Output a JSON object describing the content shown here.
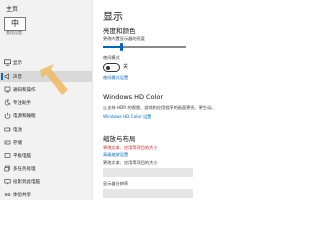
{
  "sidebar": {
    "title": "主页",
    "search_value": "中",
    "search_caption": "查找设置",
    "items": [
      {
        "label": "显示",
        "icon": "monitor-icon"
      },
      {
        "label": "声音",
        "icon": "speaker-icon",
        "selected": true
      },
      {
        "label": "通知和操作",
        "icon": "notification-icon"
      },
      {
        "label": "专注助手",
        "icon": "moon-icon"
      },
      {
        "label": "电源和睡眠",
        "icon": "power-icon"
      },
      {
        "label": "电池",
        "icon": "battery-icon"
      },
      {
        "label": "存储",
        "icon": "storage-icon"
      },
      {
        "label": "平板电脑",
        "icon": "tablet-icon"
      },
      {
        "label": "多任务处理",
        "icon": "multitask-icon"
      },
      {
        "label": "投影到此电脑",
        "icon": "project-icon"
      },
      {
        "label": "体验共享",
        "icon": "share-icon"
      }
    ]
  },
  "main": {
    "title": "显示",
    "brightness_section": "亮度和颜色",
    "brightness_label": "更改内置显示器的亮度",
    "brightness_percent": 22,
    "night_light_label": "夜间模式",
    "night_light_state": "关",
    "night_light_link": "夜间模式设置",
    "hdr_section": "Windows HD Color",
    "hdr_desc": "让支持 HDR 的视频、游戏和应用程序的画面更亮、更生动。",
    "hdr_link": "Windows HD Color 设置",
    "scale_section": "缩放与布局",
    "scale_link1": "更改文本、应用等项目的大小",
    "scale_link2": "高级缩放设置",
    "scale_label": "更改文本、应用等项目的大小",
    "scale_value": "",
    "resolution_label": "显示器分辨率",
    "resolution_value": ""
  },
  "colors": {
    "accent": "#0067c0",
    "pointer": "#f0b860",
    "link_red": "#d02020"
  }
}
